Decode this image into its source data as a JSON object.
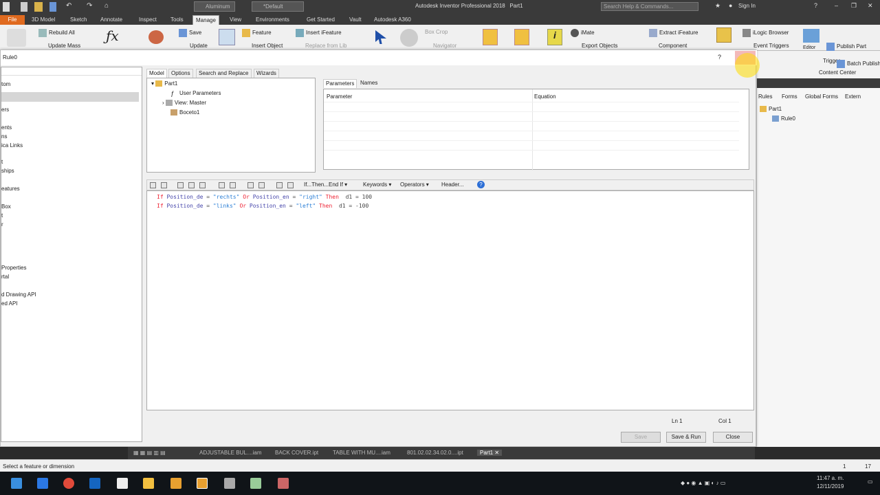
{
  "app": {
    "title": "Autodesk Inventor Professional 2018",
    "doc": "Part1",
    "material": "Aluminum",
    "appearance": "*Default",
    "search_placeholder": "Search Help & Commands...",
    "signin": "Sign In"
  },
  "ribbon_tabs": [
    "File",
    "3D Model",
    "Sketch",
    "Annotate",
    "Inspect",
    "Tools",
    "Manage",
    "View",
    "Environments",
    "Get Started",
    "Vault",
    "Autodesk A360"
  ],
  "active_tab": "Manage",
  "ribbon": {
    "rebuild_all": "Rebuild All",
    "update_mass": "Update Mass",
    "save": "Save",
    "update": "Update",
    "feature": "Feature",
    "insert_object": "Insert Object",
    "insert_ifeature": "Insert iFeature",
    "replace_from_lib": "Replace from Lib",
    "box_crop": "Box Crop",
    "navigator": "Navigator",
    "imate": "iMate",
    "export_objects": "Export Objects",
    "extract_ifeature": "Extract iFeature",
    "component": "Component",
    "ilogic_browser": "iLogic Browser",
    "event_triggers": "Event Triggers",
    "trigger": "Trigger",
    "editor": "Editor",
    "publish_part": "Publish Part",
    "batch_publish": "Batch Publish",
    "content_center": "Content Center"
  },
  "dialog": {
    "title": "Rule0",
    "help": "?",
    "tabs": [
      "Model",
      "Options",
      "Search and Replace",
      "Wizards"
    ],
    "active_tab": "Model",
    "left_items": [
      "tom",
      "ers",
      "ents",
      "ns",
      "ica Links",
      "t",
      "ships",
      "eatures",
      "Box",
      "t",
      "r",
      "Properties",
      "rtal",
      "d Drawing API",
      "ed API"
    ],
    "tree": {
      "root": "Part1",
      "user_parameters": "User Parameters",
      "view": "View: Master",
      "sketch": "Boceto1"
    },
    "param_tabs": [
      "Parameters",
      "Names"
    ],
    "param_columns": [
      "Parameter",
      "Equation"
    ],
    "toolbar": {
      "ifthen": "If...Then...End If",
      "keywords": "Keywords",
      "operators": "Operators",
      "header": "Header..."
    },
    "code": {
      "line1": {
        "if": "If",
        "v1": "Position_de",
        "eq1": " = ",
        "s1": "\"rechts\"",
        "or": " Or ",
        "v2": "Position_en",
        "eq2": " = ",
        "s2": "\"right\"",
        "then": " Then ",
        "rest": " d1 = 100"
      },
      "line2": {
        "if": "If",
        "v1": "Position_de",
        "eq1": " = ",
        "s1": "\"links\"",
        "or": " Or ",
        "v2": "Position_en",
        "eq2": " = ",
        "s2": "\"left\"",
        "then": " Then ",
        "rest": " d1 = -100"
      }
    },
    "status_ln": "Ln 1",
    "status_col": "Col 1",
    "buttons": {
      "save": "Save",
      "save_run": "Save & Run",
      "close": "Close"
    }
  },
  "right_panel": {
    "tabs": [
      "Rules",
      "Forms",
      "Global Forms",
      "Extern"
    ],
    "tree_root": "Part1",
    "tree_child": "Rule0"
  },
  "doc_tabs": [
    "ADJUSTABLE BUL....iam",
    "BACK COVER.ipt",
    "TABLE WITH MU....iam",
    "801.02.02.34.02.0....ipt",
    "Part1"
  ],
  "statusbar": {
    "hint": "Select a feature or dimension",
    "n1": "1",
    "n2": "17"
  },
  "taskbar": {
    "time": "11:47 a. m.",
    "date": "12/11/2019"
  }
}
